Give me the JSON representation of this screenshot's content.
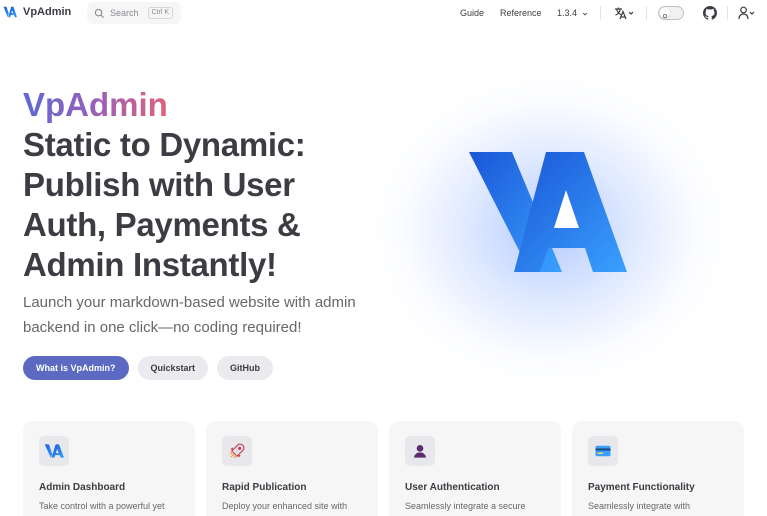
{
  "nav": {
    "title": "VpAdmin",
    "search": {
      "label": "Search",
      "shortcut": "Ctrl K"
    },
    "links": [
      {
        "label": "Guide"
      },
      {
        "label": "Reference"
      },
      {
        "label": "1.3.4"
      }
    ],
    "icons": [
      "translate-icon",
      "appearance-toggle",
      "github-icon",
      "user-icon"
    ]
  },
  "hero": {
    "name": "VpAdmin",
    "text": "Static to Dynamic: Publish with User Auth, Payments & Admin Instantly!",
    "tagline": "Launch your markdown-based website with admin backend in one click—no coding required!",
    "actions": [
      {
        "label": "What is VpAdmin?",
        "theme": "brand"
      },
      {
        "label": "Quickstart",
        "theme": "alt"
      },
      {
        "label": "GitHub",
        "theme": "alt"
      }
    ],
    "logo_text": "VA"
  },
  "features": [
    {
      "icon": "va-logo-icon",
      "title": "Admin Dashboard",
      "details": "Take control with a powerful yet"
    },
    {
      "icon": "rocket-icon",
      "title": "Rapid Publication",
      "details": "Deploy your enhanced site with"
    },
    {
      "icon": "user-icon",
      "title": "User Authentication",
      "details": "Seamlessly integrate a secure"
    },
    {
      "icon": "credit-card-icon",
      "title": "Payment Functionality",
      "details": "Seamlessly integrate with"
    }
  ],
  "colors": {
    "brand": "#5c6ac4",
    "logo_dark": "#1a56d6",
    "logo_light": "#3aa0ff",
    "text": "#3c3c43"
  }
}
